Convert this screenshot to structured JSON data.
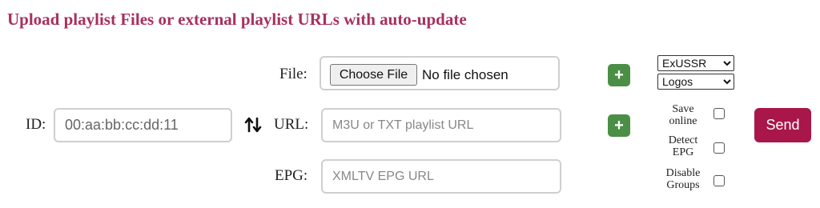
{
  "title": "Upload playlist Files or external playlist URLs with auto-update",
  "id": {
    "label": "ID:",
    "placeholder": "00:aa:bb:cc:dd:11"
  },
  "file": {
    "label": "File:",
    "button_label": "Choose File",
    "status": "No file chosen"
  },
  "url": {
    "label": "URL:",
    "placeholder": "M3U or TXT playlist URL"
  },
  "epg": {
    "label": "EPG:",
    "placeholder": "XMLTV EPG URL"
  },
  "add_buttons": {
    "file_plus": "+",
    "url_plus": "+"
  },
  "selects": {
    "country": "ExUSSR",
    "logos": "Logos"
  },
  "options": {
    "save_online": [
      "Save",
      "online"
    ],
    "detect_epg": [
      "Detect",
      "EPG"
    ],
    "disable_groups": [
      "Disable",
      "Groups"
    ]
  },
  "send_label": "Send",
  "icons": {
    "swap": "swap-vertical-icon",
    "dropdown": "chevron-down-icon"
  },
  "colors": {
    "title": "#a8305e",
    "plus": "#4a8f45",
    "send": "#a8164a"
  }
}
